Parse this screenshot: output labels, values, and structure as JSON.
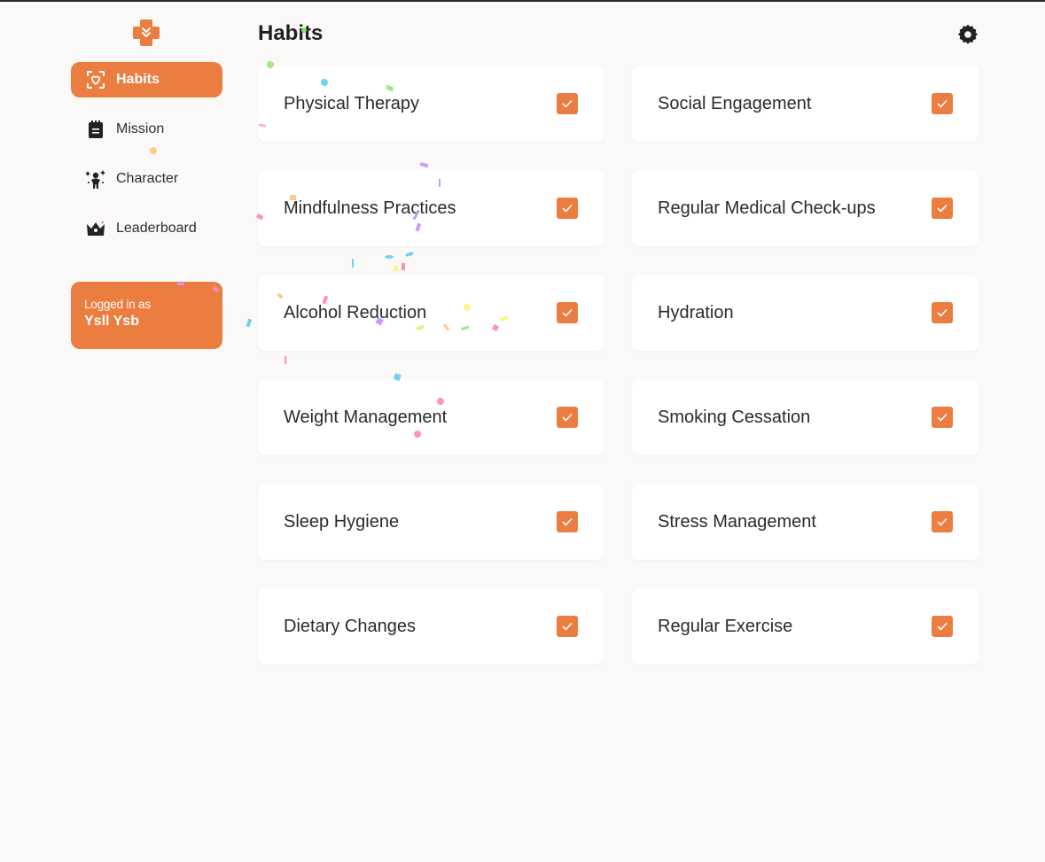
{
  "sidebar": {
    "items": [
      {
        "label": "Habits",
        "icon": "heart-frame-icon",
        "active": true
      },
      {
        "label": "Mission",
        "icon": "notepad-icon",
        "active": false
      },
      {
        "label": "Character",
        "icon": "sparkle-person-icon",
        "active": false
      },
      {
        "label": "Leaderboard",
        "icon": "crown-icon",
        "active": false
      }
    ],
    "login": {
      "line1": "Logged in as",
      "user": "Ysll Ysb"
    }
  },
  "header": {
    "title": "Habits"
  },
  "habits": [
    {
      "label": "Physical Therapy",
      "checked": true
    },
    {
      "label": "Social Engagement",
      "checked": true
    },
    {
      "label": "Mindfulness Practices",
      "checked": true
    },
    {
      "label": "Regular Medical Check-ups",
      "checked": true
    },
    {
      "label": "Alcohol Reduction",
      "checked": true
    },
    {
      "label": "Hydration",
      "checked": true
    },
    {
      "label": "Weight Management",
      "checked": true
    },
    {
      "label": "Smoking Cessation",
      "checked": true
    },
    {
      "label": "Sleep Hygiene",
      "checked": true
    },
    {
      "label": "Stress Management",
      "checked": true
    },
    {
      "label": "Dietary Changes",
      "checked": true
    },
    {
      "label": "Regular Exercise",
      "checked": true
    }
  ],
  "colors": {
    "accent": "#ec7d40",
    "background": "#faf9f7",
    "card": "#ffffff"
  }
}
